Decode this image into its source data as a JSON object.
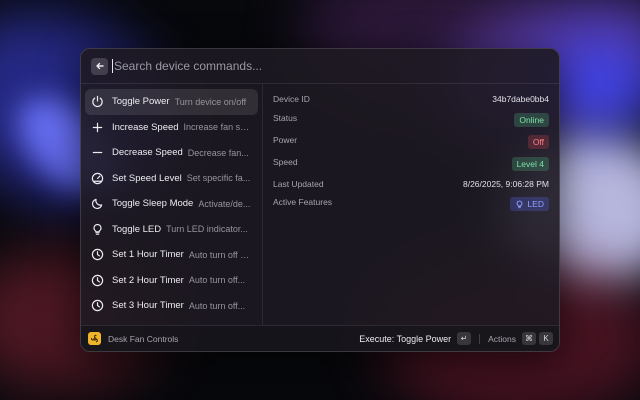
{
  "search": {
    "placeholder": "Search device commands..."
  },
  "commands": [
    {
      "title": "Toggle Power",
      "subtitle": "Turn device on/off",
      "icon": "power-icon"
    },
    {
      "title": "Increase Speed",
      "subtitle": "Increase fan sp...",
      "icon": "plus-icon"
    },
    {
      "title": "Decrease Speed",
      "subtitle": "Decrease fan...",
      "icon": "minus-icon"
    },
    {
      "title": "Set Speed Level",
      "subtitle": "Set specific fa...",
      "icon": "gauge-icon"
    },
    {
      "title": "Toggle Sleep Mode",
      "subtitle": "Activate/de...",
      "icon": "moon-icon"
    },
    {
      "title": "Toggle LED",
      "subtitle": "Turn LED indicator...",
      "icon": "bulb-icon"
    },
    {
      "title": "Set 1 Hour Timer",
      "subtitle": "Auto turn off a...",
      "icon": "clock-icon"
    },
    {
      "title": "Set 2 Hour Timer",
      "subtitle": "Auto turn off...",
      "icon": "clock-icon"
    },
    {
      "title": "Set 3 Hour Timer",
      "subtitle": "Auto turn off...",
      "icon": "clock-icon"
    }
  ],
  "detail": {
    "device_id_label": "Device ID",
    "device_id_value": "34b7dabe0bb4",
    "status_label": "Status",
    "status_value": "Online",
    "power_label": "Power",
    "power_value": "Off",
    "speed_label": "Speed",
    "speed_value": "Level 4",
    "updated_label": "Last Updated",
    "updated_value": "8/26/2025, 9:06:28 PM",
    "features_label": "Active Features",
    "features_value": "LED"
  },
  "footer": {
    "app_name": "Desk Fan Controls",
    "execute_label": "Execute: Toggle Power",
    "enter_key": "↵",
    "actions_label": "Actions",
    "cmd_key": "⌘",
    "k_key": "K"
  },
  "colors": {
    "online": "#7fe0a8",
    "off": "#ff7f88",
    "accent": "#8fa2ff",
    "app_icon": "#f0b429"
  }
}
